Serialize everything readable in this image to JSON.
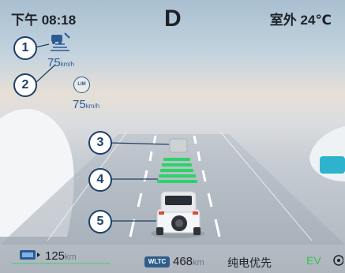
{
  "header": {
    "time": "下午 08:18",
    "gear": "D",
    "outside_temp": "室外 24℃"
  },
  "callouts": [
    "1",
    "2",
    "3",
    "4",
    "5"
  ],
  "cruise": {
    "set_speed": "75",
    "speed_unit": "km/h",
    "limit_label": "LIM",
    "limit_speed": "75"
  },
  "footer": {
    "battery_range": "125",
    "battery_range_unit": "km",
    "wltc_badge": "WLTC",
    "wltc_range": "468",
    "wltc_unit": "km",
    "drive_mode": "纯电优先",
    "ev_label": "EV"
  },
  "icons": [
    "adaptive-cruise-icon",
    "speed-limit-icon",
    "battery-icon",
    "lead-vehicle-icon",
    "ego-vehicle-icon",
    "settings-icon"
  ],
  "colors": {
    "accent": "#2a5b94",
    "ev_green": "#38c24a",
    "distance_bar": "#2bd466",
    "callout_border": "#1e3f66"
  }
}
